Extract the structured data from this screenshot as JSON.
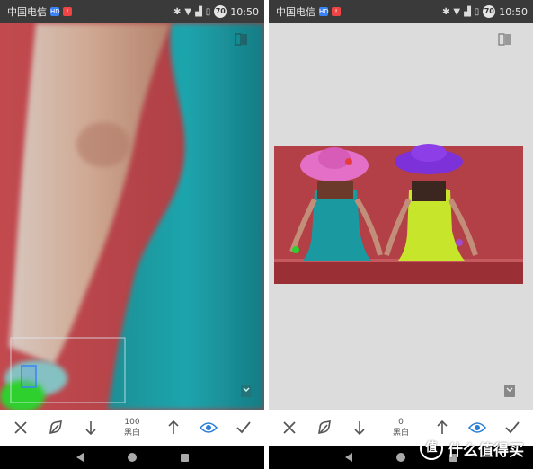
{
  "status_bar": {
    "carrier": "中国电信",
    "hd_badge": "HD",
    "time": "10:50",
    "battery_level": "70"
  },
  "left": {
    "value": "100",
    "filter_name": "黑白"
  },
  "right": {
    "value": "0",
    "filter_name": "黑白"
  },
  "watermark": {
    "logo_char": "值",
    "text": "什么值得买"
  },
  "colors": {
    "accent": "#2a7fd6",
    "toolbar_icon": "#555555",
    "status_bar_bg": "#3a3a3a"
  },
  "icons": [
    "close-icon",
    "brush-icon",
    "arrow-down-icon",
    "arrow-up-icon",
    "eye-icon",
    "check-icon",
    "compare-icon",
    "bookmark-icon"
  ]
}
